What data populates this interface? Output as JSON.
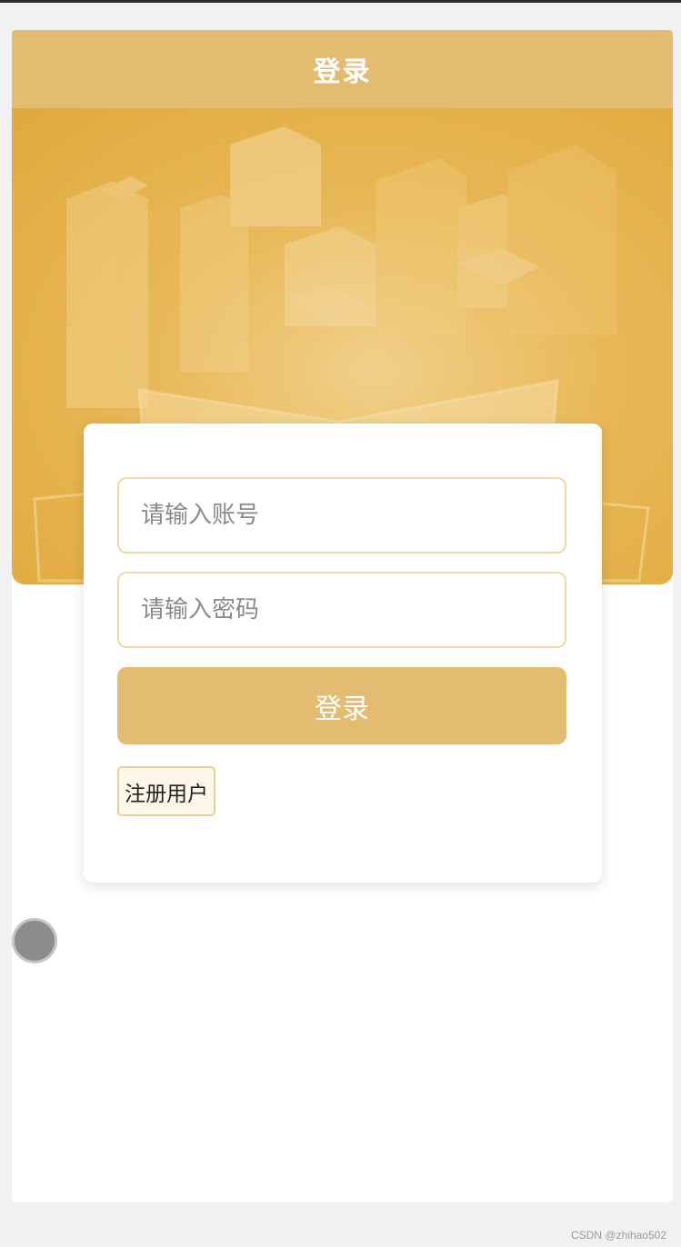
{
  "header": {
    "title": "登录"
  },
  "login_form": {
    "account_placeholder": "请输入账号",
    "account_value": "",
    "password_placeholder": "请输入密码",
    "password_value": "",
    "login_label": "登录",
    "register_label": "注册用户"
  },
  "watermark": "CSDN @zhihao502",
  "colors": {
    "brand": "#e3bc72",
    "hero_light": "#f0d08a",
    "hero_dark": "#e0a93c",
    "field_border": "#efd9a9",
    "float_dot": "#8c8c8c"
  }
}
